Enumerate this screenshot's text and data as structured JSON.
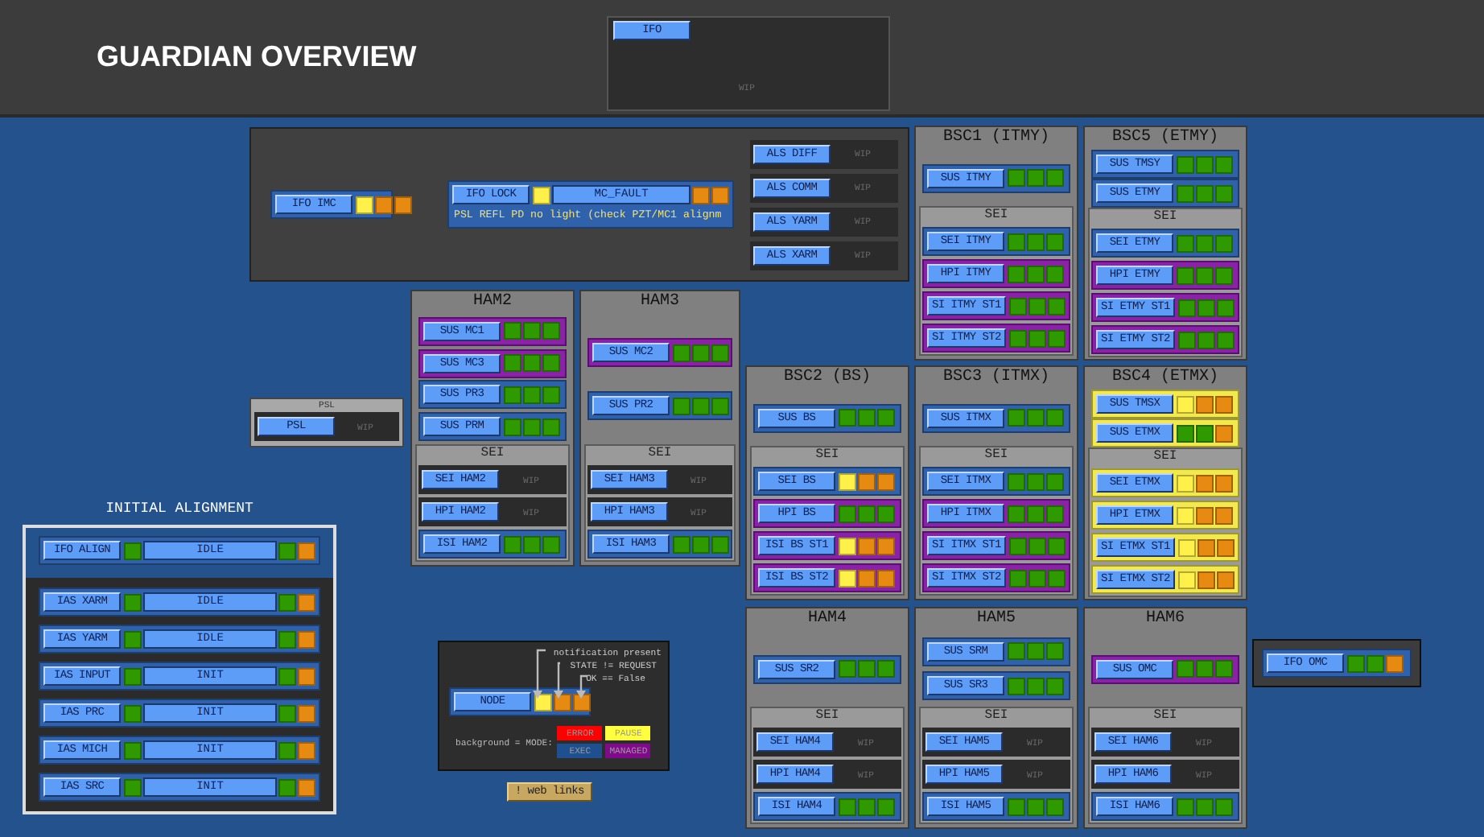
{
  "header": {
    "title": "GUARDIAN OVERVIEW",
    "ifo_panel": {
      "label": "IFO",
      "status": "WIP"
    }
  },
  "top_panel": {
    "nodes": [
      {
        "kind": "status",
        "label": "IFO IMC",
        "managed": false,
        "paused": false,
        "parts": [
          {
            "kind": "light",
            "color": "#fff04a"
          },
          {
            "kind": "light",
            "color": "#e68a12"
          },
          {
            "kind": "light",
            "color": "#e68a12"
          }
        ]
      },
      {
        "kind": "status",
        "label": "IFO LOCK",
        "managed": false,
        "paused": false,
        "parts": [
          {
            "kind": "light",
            "color": "#fff04a"
          },
          {
            "kind": "state",
            "text": "MC_FAULT"
          },
          {
            "kind": "light",
            "color": "#e68a12"
          },
          {
            "kind": "light",
            "color": "#e68a12"
          }
        ],
        "message": "PSL REFL PD no light (check PZT/MC1 alignm"
      }
    ],
    "als": [
      {
        "kind": "wip",
        "label": "ALS DIFF",
        "status": "WIP"
      },
      {
        "kind": "wip",
        "label": "ALS COMM",
        "status": "WIP"
      },
      {
        "kind": "wip",
        "label": "ALS YARM",
        "status": "WIP"
      },
      {
        "kind": "wip",
        "label": "ALS XARM",
        "status": "WIP"
      }
    ]
  },
  "chambers": [
    {
      "title": "BSC1 (ITMY)",
      "sus": [
        {
          "kind": "status",
          "label": "SUS ITMY",
          "managed": false,
          "paused": false,
          "parts": [
            {
              "kind": "light",
              "color": "#2e9a00"
            },
            {
              "kind": "light",
              "color": "#2e9a00"
            },
            {
              "kind": "light",
              "color": "#2e9a00"
            }
          ]
        }
      ],
      "sei": {
        "title": "SEI",
        "nodes": [
          {
            "kind": "status",
            "label": "SEI ITMY",
            "managed": false,
            "paused": false,
            "parts": [
              {
                "kind": "light",
                "color": "#2e9a00"
              },
              {
                "kind": "light",
                "color": "#2e9a00"
              },
              {
                "kind": "light",
                "color": "#2e9a00"
              }
            ]
          },
          {
            "kind": "status",
            "label": "HPI ITMY",
            "managed": true,
            "paused": false,
            "parts": [
              {
                "kind": "light",
                "color": "#2e9a00"
              },
              {
                "kind": "light",
                "color": "#2e9a00"
              },
              {
                "kind": "light",
                "color": "#2e9a00"
              }
            ]
          },
          {
            "kind": "status",
            "label": "SI ITMY ST1",
            "managed": true,
            "paused": false,
            "parts": [
              {
                "kind": "light",
                "color": "#2e9a00"
              },
              {
                "kind": "light",
                "color": "#2e9a00"
              },
              {
                "kind": "light",
                "color": "#2e9a00"
              }
            ]
          },
          {
            "kind": "status",
            "label": "SI ITMY ST2",
            "managed": true,
            "paused": false,
            "parts": [
              {
                "kind": "light",
                "color": "#2e9a00"
              },
              {
                "kind": "light",
                "color": "#2e9a00"
              },
              {
                "kind": "light",
                "color": "#2e9a00"
              }
            ]
          }
        ]
      }
    },
    {
      "title": "BSC5 (ETMY)",
      "sus": [
        {
          "kind": "status",
          "label": "SUS TMSY",
          "managed": false,
          "paused": false,
          "parts": [
            {
              "kind": "light",
              "color": "#2e9a00"
            },
            {
              "kind": "light",
              "color": "#2e9a00"
            },
            {
              "kind": "light",
              "color": "#2e9a00"
            }
          ]
        },
        {
          "kind": "status",
          "label": "SUS ETMY",
          "managed": false,
          "paused": false,
          "parts": [
            {
              "kind": "light",
              "color": "#2e9a00"
            },
            {
              "kind": "light",
              "color": "#2e9a00"
            },
            {
              "kind": "light",
              "color": "#2e9a00"
            }
          ]
        }
      ],
      "sei": {
        "title": "SEI",
        "nodes": [
          {
            "kind": "status",
            "label": "SEI ETMY",
            "managed": false,
            "paused": false,
            "parts": [
              {
                "kind": "light",
                "color": "#2e9a00"
              },
              {
                "kind": "light",
                "color": "#2e9a00"
              },
              {
                "kind": "light",
                "color": "#2e9a00"
              }
            ]
          },
          {
            "kind": "status",
            "label": "HPI ETMY",
            "managed": true,
            "paused": false,
            "parts": [
              {
                "kind": "light",
                "color": "#2e9a00"
              },
              {
                "kind": "light",
                "color": "#2e9a00"
              },
              {
                "kind": "light",
                "color": "#2e9a00"
              }
            ]
          },
          {
            "kind": "status",
            "label": "SI ETMY ST1",
            "managed": true,
            "paused": false,
            "parts": [
              {
                "kind": "light",
                "color": "#2e9a00"
              },
              {
                "kind": "light",
                "color": "#2e9a00"
              },
              {
                "kind": "light",
                "color": "#2e9a00"
              }
            ]
          },
          {
            "kind": "status",
            "label": "SI ETMY ST2",
            "managed": true,
            "paused": false,
            "parts": [
              {
                "kind": "light",
                "color": "#2e9a00"
              },
              {
                "kind": "light",
                "color": "#2e9a00"
              },
              {
                "kind": "light",
                "color": "#2e9a00"
              }
            ]
          }
        ]
      }
    },
    {
      "title": "HAM2",
      "sus": [
        {
          "kind": "status",
          "label": "SUS MC1",
          "managed": true,
          "paused": false,
          "parts": [
            {
              "kind": "light",
              "color": "#2e9a00"
            },
            {
              "kind": "light",
              "color": "#2e9a00"
            },
            {
              "kind": "light",
              "color": "#2e9a00"
            }
          ]
        },
        {
          "kind": "status",
          "label": "SUS MC3",
          "managed": true,
          "paused": false,
          "parts": [
            {
              "kind": "light",
              "color": "#2e9a00"
            },
            {
              "kind": "light",
              "color": "#2e9a00"
            },
            {
              "kind": "light",
              "color": "#2e9a00"
            }
          ]
        },
        {
          "kind": "status",
          "label": "SUS PR3",
          "managed": false,
          "paused": false,
          "parts": [
            {
              "kind": "light",
              "color": "#2e9a00"
            },
            {
              "kind": "light",
              "color": "#2e9a00"
            },
            {
              "kind": "light",
              "color": "#2e9a00"
            }
          ]
        },
        {
          "kind": "status",
          "label": "SUS PRM",
          "managed": false,
          "paused": false,
          "parts": [
            {
              "kind": "light",
              "color": "#2e9a00"
            },
            {
              "kind": "light",
              "color": "#2e9a00"
            },
            {
              "kind": "light",
              "color": "#2e9a00"
            }
          ]
        }
      ],
      "sei": {
        "title": "SEI",
        "nodes": [
          {
            "kind": "wip",
            "label": "SEI HAM2",
            "status": "WIP"
          },
          {
            "kind": "wip",
            "label": "HPI HAM2",
            "status": "WIP"
          },
          {
            "kind": "status",
            "label": "ISI HAM2",
            "managed": false,
            "paused": false,
            "parts": [
              {
                "kind": "light",
                "color": "#2e9a00"
              },
              {
                "kind": "light",
                "color": "#2e9a00"
              },
              {
                "kind": "light",
                "color": "#2e9a00"
              }
            ]
          }
        ]
      }
    },
    {
      "title": "HAM3",
      "sus": [
        {
          "kind": "status",
          "label": "SUS MC2",
          "managed": true,
          "paused": false,
          "parts": [
            {
              "kind": "light",
              "color": "#2e9a00"
            },
            {
              "kind": "light",
              "color": "#2e9a00"
            },
            {
              "kind": "light",
              "color": "#2e9a00"
            }
          ]
        },
        {
          "kind": "status",
          "label": "SUS PR2",
          "managed": false,
          "paused": false,
          "parts": [
            {
              "kind": "light",
              "color": "#2e9a00"
            },
            {
              "kind": "light",
              "color": "#2e9a00"
            },
            {
              "kind": "light",
              "color": "#2e9a00"
            }
          ]
        }
      ],
      "sei": {
        "title": "SEI",
        "nodes": [
          {
            "kind": "wip",
            "label": "SEI HAM3",
            "status": "WIP"
          },
          {
            "kind": "wip",
            "label": "HPI HAM3",
            "status": "WIP"
          },
          {
            "kind": "status",
            "label": "ISI HAM3",
            "managed": false,
            "paused": false,
            "parts": [
              {
                "kind": "light",
                "color": "#2e9a00"
              },
              {
                "kind": "light",
                "color": "#2e9a00"
              },
              {
                "kind": "light",
                "color": "#2e9a00"
              }
            ]
          }
        ]
      }
    },
    {
      "title": "BSC2 (BS)",
      "sus": [
        {
          "kind": "status",
          "label": "SUS BS",
          "managed": false,
          "paused": false,
          "parts": [
            {
              "kind": "light",
              "color": "#2e9a00"
            },
            {
              "kind": "light",
              "color": "#2e9a00"
            },
            {
              "kind": "light",
              "color": "#2e9a00"
            }
          ]
        }
      ],
      "sei": {
        "title": "SEI",
        "nodes": [
          {
            "kind": "status",
            "label": "SEI BS",
            "managed": false,
            "paused": false,
            "parts": [
              {
                "kind": "light",
                "color": "#fff04a"
              },
              {
                "kind": "light",
                "color": "#e68a12"
              },
              {
                "kind": "light",
                "color": "#e68a12"
              }
            ]
          },
          {
            "kind": "status",
            "label": "HPI BS",
            "managed": true,
            "paused": false,
            "parts": [
              {
                "kind": "light",
                "color": "#2e9a00"
              },
              {
                "kind": "light",
                "color": "#2e9a00"
              },
              {
                "kind": "light",
                "color": "#2e9a00"
              }
            ]
          },
          {
            "kind": "status",
            "label": "ISI BS ST1",
            "managed": true,
            "paused": false,
            "parts": [
              {
                "kind": "light",
                "color": "#fff04a"
              },
              {
                "kind": "light",
                "color": "#e68a12"
              },
              {
                "kind": "light",
                "color": "#e68a12"
              }
            ]
          },
          {
            "kind": "status",
            "label": "ISI BS ST2",
            "managed": true,
            "paused": false,
            "parts": [
              {
                "kind": "light",
                "color": "#fff04a"
              },
              {
                "kind": "light",
                "color": "#e68a12"
              },
              {
                "kind": "light",
                "color": "#e68a12"
              }
            ]
          }
        ]
      }
    },
    {
      "title": "BSC3 (ITMX)",
      "sus": [
        {
          "kind": "status",
          "label": "SUS ITMX",
          "managed": false,
          "paused": false,
          "parts": [
            {
              "kind": "light",
              "color": "#2e9a00"
            },
            {
              "kind": "light",
              "color": "#2e9a00"
            },
            {
              "kind": "light",
              "color": "#2e9a00"
            }
          ]
        }
      ],
      "sei": {
        "title": "SEI",
        "nodes": [
          {
            "kind": "status",
            "label": "SEI ITMX",
            "managed": false,
            "paused": false,
            "parts": [
              {
                "kind": "light",
                "color": "#2e9a00"
              },
              {
                "kind": "light",
                "color": "#2e9a00"
              },
              {
                "kind": "light",
                "color": "#2e9a00"
              }
            ]
          },
          {
            "kind": "status",
            "label": "HPI ITMX",
            "managed": true,
            "paused": false,
            "parts": [
              {
                "kind": "light",
                "color": "#2e9a00"
              },
              {
                "kind": "light",
                "color": "#2e9a00"
              },
              {
                "kind": "light",
                "color": "#2e9a00"
              }
            ]
          },
          {
            "kind": "status",
            "label": "SI ITMX ST1",
            "managed": true,
            "paused": false,
            "parts": [
              {
                "kind": "light",
                "color": "#2e9a00"
              },
              {
                "kind": "light",
                "color": "#2e9a00"
              },
              {
                "kind": "light",
                "color": "#2e9a00"
              }
            ]
          },
          {
            "kind": "status",
            "label": "SI ITMX ST2",
            "managed": true,
            "paused": false,
            "parts": [
              {
                "kind": "light",
                "color": "#2e9a00"
              },
              {
                "kind": "light",
                "color": "#2e9a00"
              },
              {
                "kind": "light",
                "color": "#2e9a00"
              }
            ]
          }
        ]
      }
    },
    {
      "title": "BSC4 (ETMX)",
      "sus": [
        {
          "kind": "status",
          "label": "SUS TMSX",
          "managed": false,
          "paused": true,
          "parts": [
            {
              "kind": "light",
              "color": "#fff04a"
            },
            {
              "kind": "light",
              "color": "#e68a12"
            },
            {
              "kind": "light",
              "color": "#e68a12"
            }
          ]
        },
        {
          "kind": "status",
          "label": "SUS ETMX",
          "managed": false,
          "paused": true,
          "parts": [
            {
              "kind": "light",
              "color": "#2e9a00"
            },
            {
              "kind": "light",
              "color": "#2e9a00"
            },
            {
              "kind": "light",
              "color": "#e68a12"
            }
          ]
        }
      ],
      "sei": {
        "title": "SEI",
        "nodes": [
          {
            "kind": "status",
            "label": "SEI ETMX",
            "managed": false,
            "paused": true,
            "parts": [
              {
                "kind": "light",
                "color": "#fff04a"
              },
              {
                "kind": "light",
                "color": "#e68a12"
              },
              {
                "kind": "light",
                "color": "#e68a12"
              }
            ]
          },
          {
            "kind": "status",
            "label": "HPI ETMX",
            "managed": false,
            "paused": true,
            "parts": [
              {
                "kind": "light",
                "color": "#fff04a"
              },
              {
                "kind": "light",
                "color": "#e68a12"
              },
              {
                "kind": "light",
                "color": "#e68a12"
              }
            ]
          },
          {
            "kind": "status",
            "label": "SI ETMX ST1",
            "managed": false,
            "paused": true,
            "parts": [
              {
                "kind": "light",
                "color": "#fff04a"
              },
              {
                "kind": "light",
                "color": "#e68a12"
              },
              {
                "kind": "light",
                "color": "#e68a12"
              }
            ]
          },
          {
            "kind": "status",
            "label": "SI ETMX ST2",
            "managed": false,
            "paused": true,
            "parts": [
              {
                "kind": "light",
                "color": "#fff04a"
              },
              {
                "kind": "light",
                "color": "#e68a12"
              },
              {
                "kind": "light",
                "color": "#e68a12"
              }
            ]
          }
        ]
      }
    },
    {
      "title": "HAM4",
      "sus": [
        {
          "kind": "status",
          "label": "SUS SR2",
          "managed": false,
          "paused": false,
          "parts": [
            {
              "kind": "light",
              "color": "#2e9a00"
            },
            {
              "kind": "light",
              "color": "#2e9a00"
            },
            {
              "kind": "light",
              "color": "#2e9a00"
            }
          ]
        }
      ],
      "sei": {
        "title": "SEI",
        "nodes": [
          {
            "kind": "wip",
            "label": "SEI HAM4",
            "status": "WIP"
          },
          {
            "kind": "wip",
            "label": "HPI HAM4",
            "status": "WIP"
          },
          {
            "kind": "status",
            "label": "ISI HAM4",
            "managed": false,
            "paused": false,
            "parts": [
              {
                "kind": "light",
                "color": "#2e9a00"
              },
              {
                "kind": "light",
                "color": "#2e9a00"
              },
              {
                "kind": "light",
                "color": "#2e9a00"
              }
            ]
          }
        ]
      }
    },
    {
      "title": "HAM5",
      "sus": [
        {
          "kind": "status",
          "label": "SUS SRM",
          "managed": false,
          "paused": false,
          "parts": [
            {
              "kind": "light",
              "color": "#2e9a00"
            },
            {
              "kind": "light",
              "color": "#2e9a00"
            },
            {
              "kind": "light",
              "color": "#2e9a00"
            }
          ]
        },
        {
          "kind": "status",
          "label": "SUS SR3",
          "managed": false,
          "paused": false,
          "parts": [
            {
              "kind": "light",
              "color": "#2e9a00"
            },
            {
              "kind": "light",
              "color": "#2e9a00"
            },
            {
              "kind": "light",
              "color": "#2e9a00"
            }
          ]
        }
      ],
      "sei": {
        "title": "SEI",
        "nodes": [
          {
            "kind": "wip",
            "label": "SEI HAM5",
            "status": "WIP"
          },
          {
            "kind": "wip",
            "label": "HPI HAM5",
            "status": "WIP"
          },
          {
            "kind": "status",
            "label": "ISI HAM5",
            "managed": false,
            "paused": false,
            "parts": [
              {
                "kind": "light",
                "color": "#2e9a00"
              },
              {
                "kind": "light",
                "color": "#2e9a00"
              },
              {
                "kind": "light",
                "color": "#2e9a00"
              }
            ]
          }
        ]
      }
    },
    {
      "title": "HAM6",
      "sus": [
        {
          "kind": "status",
          "label": "SUS OMC",
          "managed": true,
          "paused": false,
          "parts": [
            {
              "kind": "light",
              "color": "#2e9a00"
            },
            {
              "kind": "light",
              "color": "#2e9a00"
            },
            {
              "kind": "light",
              "color": "#2e9a00"
            }
          ]
        }
      ],
      "sei": {
        "title": "SEI",
        "nodes": [
          {
            "kind": "wip",
            "label": "SEI HAM6",
            "status": "WIP"
          },
          {
            "kind": "wip",
            "label": "HPI HAM6",
            "status": "WIP"
          },
          {
            "kind": "status",
            "label": "ISI HAM6",
            "managed": false,
            "paused": false,
            "parts": [
              {
                "kind": "light",
                "color": "#2e9a00"
              },
              {
                "kind": "light",
                "color": "#2e9a00"
              },
              {
                "kind": "light",
                "color": "#2e9a00"
              }
            ]
          }
        ]
      }
    }
  ],
  "psl": {
    "title": "PSL",
    "node": {
      "kind": "wip",
      "label": "PSL",
      "status": "WIP"
    }
  },
  "initial_alignment": {
    "title": "INITIAL ALIGNMENT",
    "main": {
      "kind": "status",
      "label": "IFO ALIGN",
      "managed": false,
      "paused": false,
      "parts": [
        {
          "kind": "light",
          "color": "#2e9a00"
        },
        {
          "kind": "state",
          "text": "IDLE"
        },
        {
          "kind": "light",
          "color": "#2e9a00"
        },
        {
          "kind": "light",
          "color": "#e68a12"
        }
      ]
    },
    "nodes": [
      {
        "kind": "status",
        "label": "IAS XARM",
        "managed": false,
        "paused": false,
        "parts": [
          {
            "kind": "light",
            "color": "#2e9a00"
          },
          {
            "kind": "state",
            "text": "IDLE"
          },
          {
            "kind": "light",
            "color": "#2e9a00"
          },
          {
            "kind": "light",
            "color": "#e68a12"
          }
        ]
      },
      {
        "kind": "status",
        "label": "IAS YARM",
        "managed": false,
        "paused": false,
        "parts": [
          {
            "kind": "light",
            "color": "#2e9a00"
          },
          {
            "kind": "state",
            "text": "IDLE"
          },
          {
            "kind": "light",
            "color": "#2e9a00"
          },
          {
            "kind": "light",
            "color": "#e68a12"
          }
        ]
      },
      {
        "kind": "status",
        "label": "IAS INPUT",
        "managed": false,
        "paused": false,
        "parts": [
          {
            "kind": "light",
            "color": "#2e9a00"
          },
          {
            "kind": "state",
            "text": "INIT"
          },
          {
            "kind": "light",
            "color": "#2e9a00"
          },
          {
            "kind": "light",
            "color": "#e68a12"
          }
        ]
      },
      {
        "kind": "status",
        "label": "IAS PRC",
        "managed": false,
        "paused": false,
        "parts": [
          {
            "kind": "light",
            "color": "#2e9a00"
          },
          {
            "kind": "state",
            "text": "INIT"
          },
          {
            "kind": "light",
            "color": "#2e9a00"
          },
          {
            "kind": "light",
            "color": "#e68a12"
          }
        ]
      },
      {
        "kind": "status",
        "label": "IAS MICH",
        "managed": false,
        "paused": false,
        "parts": [
          {
            "kind": "light",
            "color": "#2e9a00"
          },
          {
            "kind": "state",
            "text": "INIT"
          },
          {
            "kind": "light",
            "color": "#2e9a00"
          },
          {
            "kind": "light",
            "color": "#e68a12"
          }
        ]
      },
      {
        "kind": "status",
        "label": "IAS SRC",
        "managed": false,
        "paused": false,
        "parts": [
          {
            "kind": "light",
            "color": "#2e9a00"
          },
          {
            "kind": "state",
            "text": "INIT"
          },
          {
            "kind": "light",
            "color": "#2e9a00"
          },
          {
            "kind": "light",
            "color": "#e68a12"
          }
        ]
      }
    ]
  },
  "legend": {
    "notes": [
      "notification present",
      "STATE != REQUEST",
      "OK == False"
    ],
    "node": {
      "kind": "status",
      "label": "NODE",
      "managed": false,
      "paused": false,
      "parts": [
        {
          "kind": "light",
          "color": "#fff04a"
        },
        {
          "kind": "light",
          "color": "#e68a12"
        },
        {
          "kind": "light",
          "color": "#e68a12"
        }
      ]
    },
    "caption": "background = MODE:",
    "modes": [
      {
        "label": "ERROR",
        "color": "#ff0000"
      },
      {
        "label": "PAUSE",
        "color": "#ffff40"
      },
      {
        "label": "EXEC",
        "color": "#1e4f8f"
      },
      {
        "label": "MANAGED",
        "color": "#800b8a"
      }
    ]
  },
  "web_links": "! web links",
  "omc": {
    "node": {
      "kind": "status",
      "label": "IFO OMC",
      "managed": false,
      "paused": false,
      "parts": [
        {
          "kind": "light",
          "color": "#2e9a00"
        },
        {
          "kind": "light",
          "color": "#2e9a00"
        },
        {
          "kind": "light",
          "color": "#e68a12"
        }
      ]
    }
  }
}
